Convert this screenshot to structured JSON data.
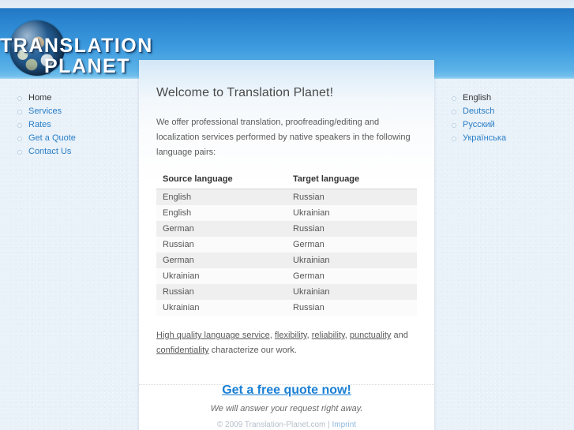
{
  "header": {
    "logo_line1": "TRANSLATION",
    "logo_line2": "PLANET",
    "globe_icon": "globe-icon"
  },
  "main_nav": {
    "items": [
      {
        "label": "Home",
        "active": true
      },
      {
        "label": "Services",
        "active": false
      },
      {
        "label": "Rates",
        "active": false
      },
      {
        "label": "Get a Quote",
        "active": false
      },
      {
        "label": "Contact Us",
        "active": false
      }
    ]
  },
  "language_nav": {
    "items": [
      {
        "label": "English",
        "active": true
      },
      {
        "label": "Deutsch",
        "active": false
      },
      {
        "label": "Русский",
        "active": false
      },
      {
        "label": "Українська",
        "active": false
      }
    ]
  },
  "content": {
    "heading": "Welcome to Translation Planet!",
    "intro": "We offer professional translation, proofreading/editing and localization services performed by native speakers in the following language pairs:",
    "table": {
      "headers": [
        "Source language",
        "Target language"
      ],
      "rows": [
        [
          "English",
          "Russian"
        ],
        [
          "English",
          "Ukrainian"
        ],
        [
          "German",
          "Russian"
        ],
        [
          "Russian",
          "German"
        ],
        [
          "German",
          "Ukrainian"
        ],
        [
          "Ukrainian",
          "German"
        ],
        [
          "Russian",
          "Ukrainian"
        ],
        [
          "Ukrainian",
          "Russian"
        ]
      ]
    },
    "features": {
      "link1": "High quality language service",
      "sep1": ", ",
      "link2": "flexibility",
      "sep2": ", ",
      "link3": "reliability",
      "sep3": ", ",
      "link4": "punctuality",
      "sep4": " and ",
      "link5": "confidentiality",
      "tail": " characterize our work."
    },
    "cta": {
      "link": "Get a free quote now!",
      "subtitle": "We will answer your request right away."
    }
  },
  "footer": {
    "copyright": "© 2009 Translation-Planet.com | ",
    "imprint": "Imprint"
  },
  "colors": {
    "header_blue": "#2a84cf",
    "link_blue": "#2a7fc6",
    "cta_blue": "#1a7fd4",
    "page_bg": "#e9f1f9",
    "row_stripe": "#efefef"
  }
}
